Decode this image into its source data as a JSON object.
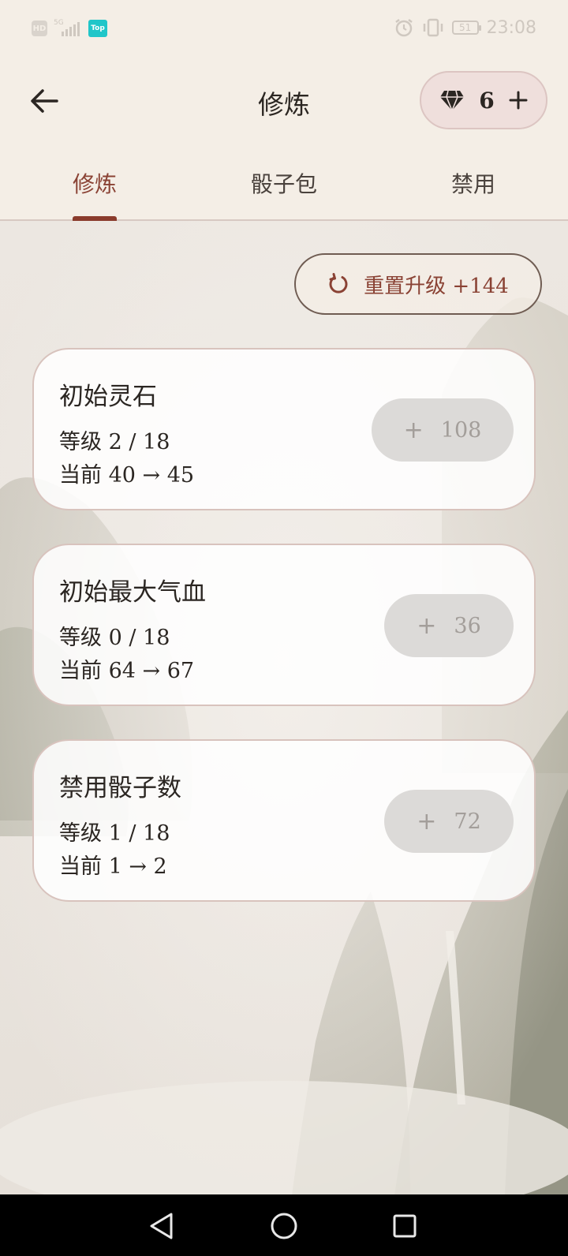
{
  "status_bar": {
    "hd": "HD",
    "network": "5G",
    "app_badge": "Top",
    "battery": "51",
    "time": "23:08"
  },
  "header": {
    "title": "修炼",
    "gem_count": "6"
  },
  "tabs": [
    {
      "label": "修炼",
      "active": true
    },
    {
      "label": "骰子包",
      "active": false
    },
    {
      "label": "禁用",
      "active": false
    }
  ],
  "reset_button": {
    "label": "重置升级 +144"
  },
  "cards": [
    {
      "title": "初始灵石",
      "level": "等级 2 / 18",
      "current": "当前 40 → 45",
      "cost": "108"
    },
    {
      "title": "初始最大气血",
      "level": "等级 0 / 18",
      "current": "当前 64 → 67",
      "cost": "36"
    },
    {
      "title": "禁用骰子数",
      "level": "等级 1 / 18",
      "current": "当前 1 → 2",
      "cost": "72"
    }
  ],
  "colors": {
    "accent": "#8a3b2c",
    "background": "#f4eee6",
    "gem_pill": "#efdfdc",
    "disabled_button": "#dcdad8"
  },
  "icons": {
    "back": "arrow-left-icon",
    "gem": "diamond-icon",
    "add": "plus-icon",
    "reset": "refresh-icon",
    "nav": [
      "triangle-back-icon",
      "circle-home-icon",
      "square-recents-icon"
    ]
  }
}
